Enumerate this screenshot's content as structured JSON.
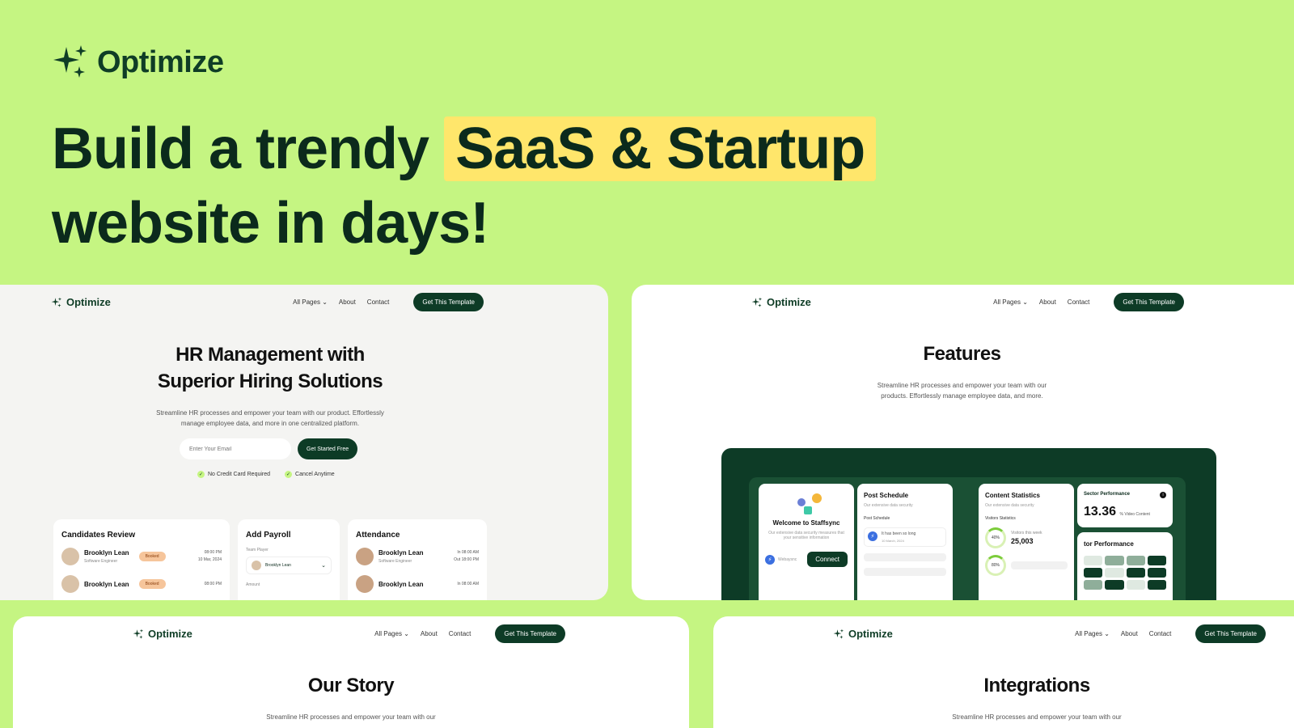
{
  "hero": {
    "brand": "Optimize",
    "title_part1": "Build a trendy",
    "title_highlight": "SaaS & Startup",
    "title_part2": "website in days!"
  },
  "nav": {
    "brand": "Optimize",
    "all_pages": "All Pages",
    "about": "About",
    "contact": "Contact",
    "cta": "Get This Template"
  },
  "card_hr": {
    "title_line1": "HR Management with",
    "title_line2": "Superior Hiring Solutions",
    "subtitle_line1": "Streamline HR processes and empower your team with our product. Effortlessly",
    "subtitle_line2": "manage employee data, and more in one centralized platform.",
    "email_placeholder": "Enter Your Email",
    "start_button": "Get Started Free",
    "check1": "No Credit Card Required",
    "check2": "Cancel Anytime",
    "candidates": {
      "title": "Candidates Review",
      "rows": [
        {
          "name": "Brooklyn Lean",
          "role": "Software Engineer",
          "badge": "Booked",
          "time": "08:00 PM",
          "date": "10 Mar, 2024"
        },
        {
          "name": "Brooklyn Lean",
          "role": "",
          "badge": "Booked",
          "time": "08:00 PM",
          "date": ""
        }
      ]
    },
    "payroll": {
      "title": "Add Payroll",
      "team_player_label": "Team Player",
      "selected_player": "Brooklyn Lean",
      "amount_label": "Amount"
    },
    "attendance": {
      "title": "Attendance",
      "rows": [
        {
          "name": "Brooklyn Lean",
          "role": "Software Engineer",
          "in": "In 08:00 AM",
          "out": "Out 18:00 PM"
        },
        {
          "name": "Brooklyn Lean",
          "role": "",
          "in": "In 08:00 AM",
          "out": ""
        }
      ]
    }
  },
  "card_features": {
    "title": "Features",
    "subtitle_line1": "Streamline HR processes and empower your team with our",
    "subtitle_line2": "products. Effortlessly manage employee data, and more.",
    "welcome": {
      "title": "Welcome to Staffsync",
      "desc": "Our extensive data security measures that your sensitive information",
      "input": "Webaysnc",
      "button": "Connect"
    },
    "post": {
      "title": "Post Schedule",
      "desc": "Our extensive data security",
      "label": "Post Schedule",
      "item": "It has been so long",
      "item_date": "10 March, 2024"
    },
    "content": {
      "title": "Content Statistics",
      "desc": "Our extensive data security",
      "label": "Visitors Statistics",
      "ring1": "40%",
      "visitors_label": "Visitors this week",
      "visitors_value": "25,003",
      "ring2": "80%"
    },
    "sector": {
      "title": "Sector Performance",
      "value": "13.36",
      "unit": "% Video Content",
      "title2": "tor Performance"
    }
  },
  "card_story": {
    "title": "Our Story",
    "subtitle": "Streamline HR processes and empower your team with our"
  },
  "card_integrations": {
    "title": "Integrations",
    "subtitle": "Streamline HR processes and empower your team with our"
  },
  "colors": {
    "background": "#c5f582",
    "dark_green": "#0d3b26",
    "highlight": "#ffe66b"
  }
}
